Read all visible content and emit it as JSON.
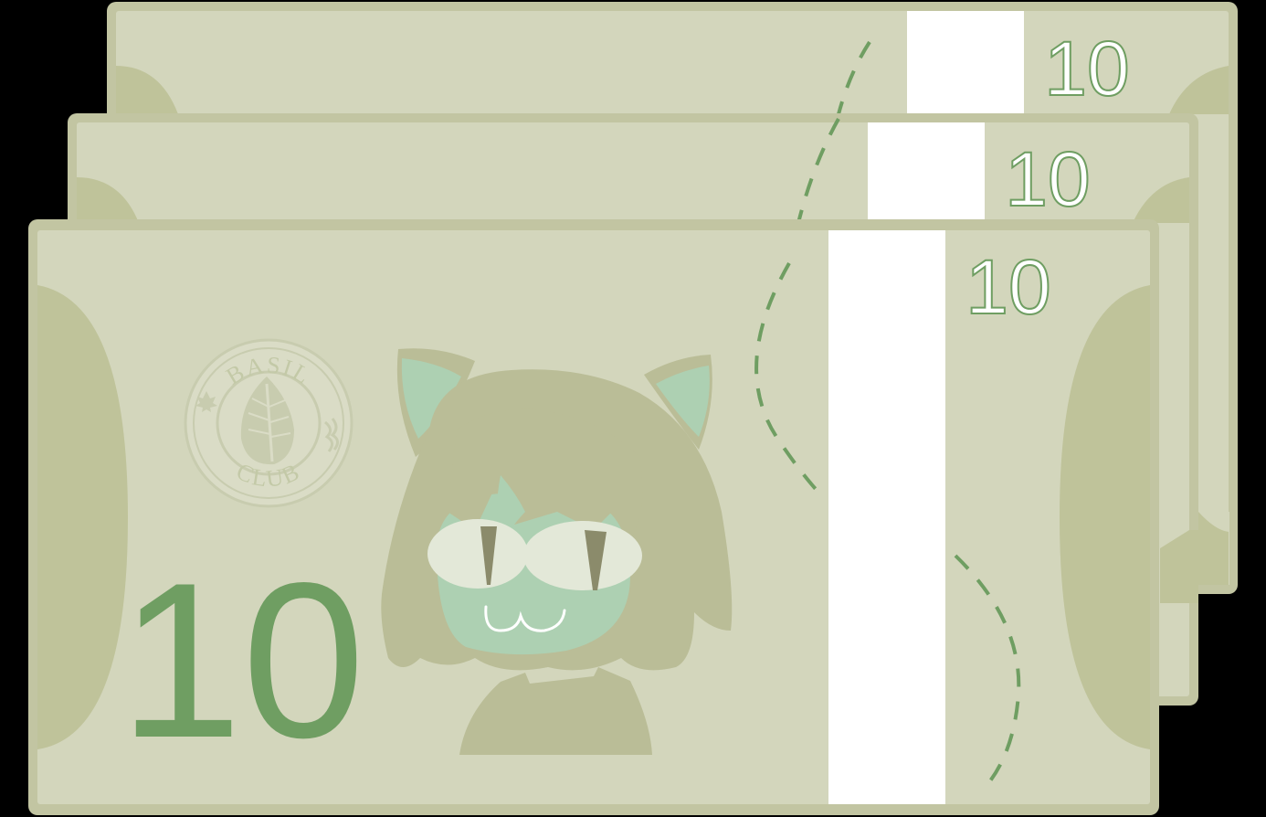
{
  "banknotes": [
    {
      "denomination": "10"
    },
    {
      "denomination": "10"
    },
    {
      "denomination": "10",
      "seal": {
        "top_text": "BASIL",
        "bottom_text": "CLUB"
      }
    }
  ],
  "colors": {
    "paper": "#d3d6bc",
    "border": "#c2c5a2",
    "oval": "#bfc39a",
    "accent_green": "#6f9e62",
    "strip": "#ffffff",
    "character_hair": "#babd97",
    "character_skin": "#add0b2",
    "character_eye_white": "#e3e8d8",
    "character_pupil": "#8b8b6b"
  },
  "icons": [
    "leaf-icon",
    "maple-leaf-icon",
    "flame-icon"
  ]
}
